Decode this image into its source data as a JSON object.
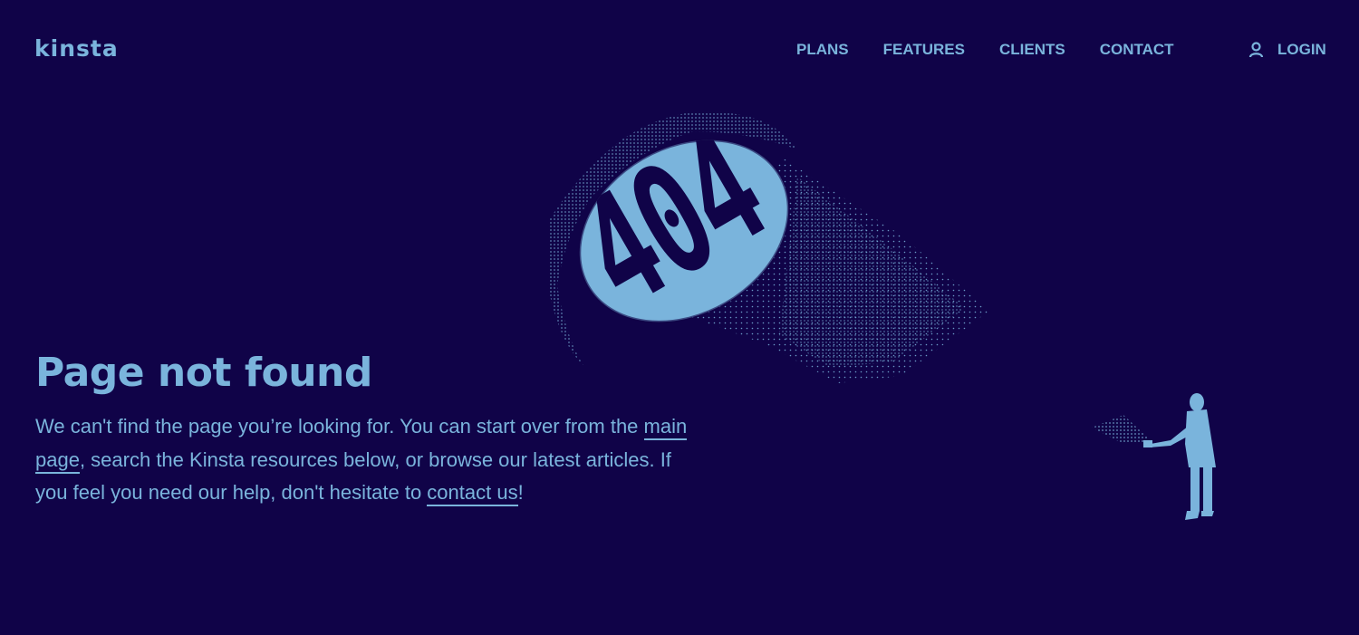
{
  "brand": {
    "logo_text": "kinsta",
    "colors": {
      "background": "#100348",
      "accent": "#7ab4dc"
    }
  },
  "nav": {
    "items": [
      {
        "label": "PLANS"
      },
      {
        "label": "FEATURES"
      },
      {
        "label": "CLIENTS"
      },
      {
        "label": "CONTACT"
      }
    ],
    "login_label": "LOGIN",
    "login_icon": "user-icon"
  },
  "illustration": {
    "code_text": "404"
  },
  "main": {
    "headline": "Page not found",
    "text_part1": "We can't find the page you’re looking for. You can start over from the ",
    "link_main_page": "main page",
    "text_part2": ", search the Kinsta resources below, or browse our latest articles. If you feel you need our help, don't hesitate to ",
    "link_contact": "contact us",
    "text_part3": "!"
  }
}
